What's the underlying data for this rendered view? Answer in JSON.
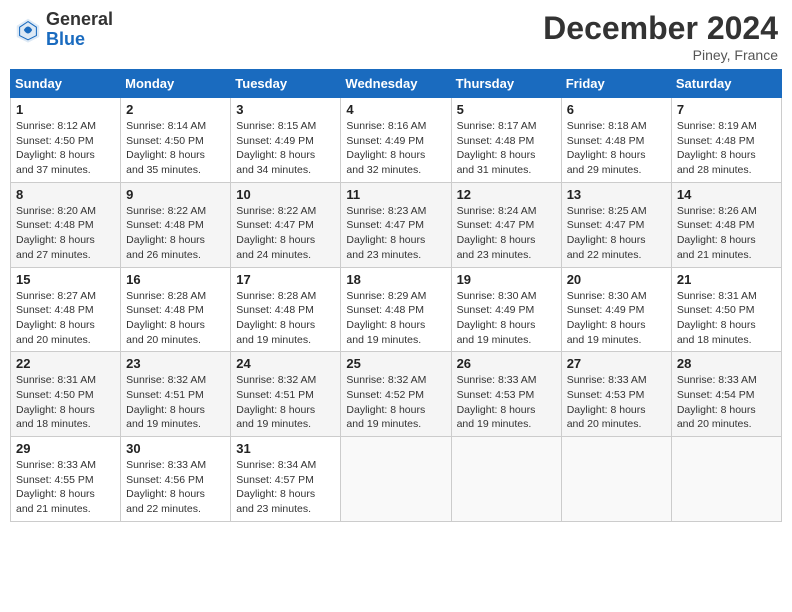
{
  "logo": {
    "general": "General",
    "blue": "Blue"
  },
  "title": "December 2024",
  "location": "Piney, France",
  "days_header": [
    "Sunday",
    "Monday",
    "Tuesday",
    "Wednesday",
    "Thursday",
    "Friday",
    "Saturday"
  ],
  "weeks": [
    [
      {
        "day": "1",
        "sunrise": "8:12 AM",
        "sunset": "4:50 PM",
        "daylight": "8 hours and 37 minutes."
      },
      {
        "day": "2",
        "sunrise": "8:14 AM",
        "sunset": "4:50 PM",
        "daylight": "8 hours and 35 minutes."
      },
      {
        "day": "3",
        "sunrise": "8:15 AM",
        "sunset": "4:49 PM",
        "daylight": "8 hours and 34 minutes."
      },
      {
        "day": "4",
        "sunrise": "8:16 AM",
        "sunset": "4:49 PM",
        "daylight": "8 hours and 32 minutes."
      },
      {
        "day": "5",
        "sunrise": "8:17 AM",
        "sunset": "4:48 PM",
        "daylight": "8 hours and 31 minutes."
      },
      {
        "day": "6",
        "sunrise": "8:18 AM",
        "sunset": "4:48 PM",
        "daylight": "8 hours and 29 minutes."
      },
      {
        "day": "7",
        "sunrise": "8:19 AM",
        "sunset": "4:48 PM",
        "daylight": "8 hours and 28 minutes."
      }
    ],
    [
      {
        "day": "8",
        "sunrise": "8:20 AM",
        "sunset": "4:48 PM",
        "daylight": "8 hours and 27 minutes."
      },
      {
        "day": "9",
        "sunrise": "8:22 AM",
        "sunset": "4:48 PM",
        "daylight": "8 hours and 26 minutes."
      },
      {
        "day": "10",
        "sunrise": "8:22 AM",
        "sunset": "4:47 PM",
        "daylight": "8 hours and 24 minutes."
      },
      {
        "day": "11",
        "sunrise": "8:23 AM",
        "sunset": "4:47 PM",
        "daylight": "8 hours and 23 minutes."
      },
      {
        "day": "12",
        "sunrise": "8:24 AM",
        "sunset": "4:47 PM",
        "daylight": "8 hours and 23 minutes."
      },
      {
        "day": "13",
        "sunrise": "8:25 AM",
        "sunset": "4:47 PM",
        "daylight": "8 hours and 22 minutes."
      },
      {
        "day": "14",
        "sunrise": "8:26 AM",
        "sunset": "4:48 PM",
        "daylight": "8 hours and 21 minutes."
      }
    ],
    [
      {
        "day": "15",
        "sunrise": "8:27 AM",
        "sunset": "4:48 PM",
        "daylight": "8 hours and 20 minutes."
      },
      {
        "day": "16",
        "sunrise": "8:28 AM",
        "sunset": "4:48 PM",
        "daylight": "8 hours and 20 minutes."
      },
      {
        "day": "17",
        "sunrise": "8:28 AM",
        "sunset": "4:48 PM",
        "daylight": "8 hours and 19 minutes."
      },
      {
        "day": "18",
        "sunrise": "8:29 AM",
        "sunset": "4:48 PM",
        "daylight": "8 hours and 19 minutes."
      },
      {
        "day": "19",
        "sunrise": "8:30 AM",
        "sunset": "4:49 PM",
        "daylight": "8 hours and 19 minutes."
      },
      {
        "day": "20",
        "sunrise": "8:30 AM",
        "sunset": "4:49 PM",
        "daylight": "8 hours and 19 minutes."
      },
      {
        "day": "21",
        "sunrise": "8:31 AM",
        "sunset": "4:50 PM",
        "daylight": "8 hours and 18 minutes."
      }
    ],
    [
      {
        "day": "22",
        "sunrise": "8:31 AM",
        "sunset": "4:50 PM",
        "daylight": "8 hours and 18 minutes."
      },
      {
        "day": "23",
        "sunrise": "8:32 AM",
        "sunset": "4:51 PM",
        "daylight": "8 hours and 19 minutes."
      },
      {
        "day": "24",
        "sunrise": "8:32 AM",
        "sunset": "4:51 PM",
        "daylight": "8 hours and 19 minutes."
      },
      {
        "day": "25",
        "sunrise": "8:32 AM",
        "sunset": "4:52 PM",
        "daylight": "8 hours and 19 minutes."
      },
      {
        "day": "26",
        "sunrise": "8:33 AM",
        "sunset": "4:53 PM",
        "daylight": "8 hours and 19 minutes."
      },
      {
        "day": "27",
        "sunrise": "8:33 AM",
        "sunset": "4:53 PM",
        "daylight": "8 hours and 20 minutes."
      },
      {
        "day": "28",
        "sunrise": "8:33 AM",
        "sunset": "4:54 PM",
        "daylight": "8 hours and 20 minutes."
      }
    ],
    [
      {
        "day": "29",
        "sunrise": "8:33 AM",
        "sunset": "4:55 PM",
        "daylight": "8 hours and 21 minutes."
      },
      {
        "day": "30",
        "sunrise": "8:33 AM",
        "sunset": "4:56 PM",
        "daylight": "8 hours and 22 minutes."
      },
      {
        "day": "31",
        "sunrise": "8:34 AM",
        "sunset": "4:57 PM",
        "daylight": "8 hours and 23 minutes."
      },
      null,
      null,
      null,
      null
    ]
  ]
}
